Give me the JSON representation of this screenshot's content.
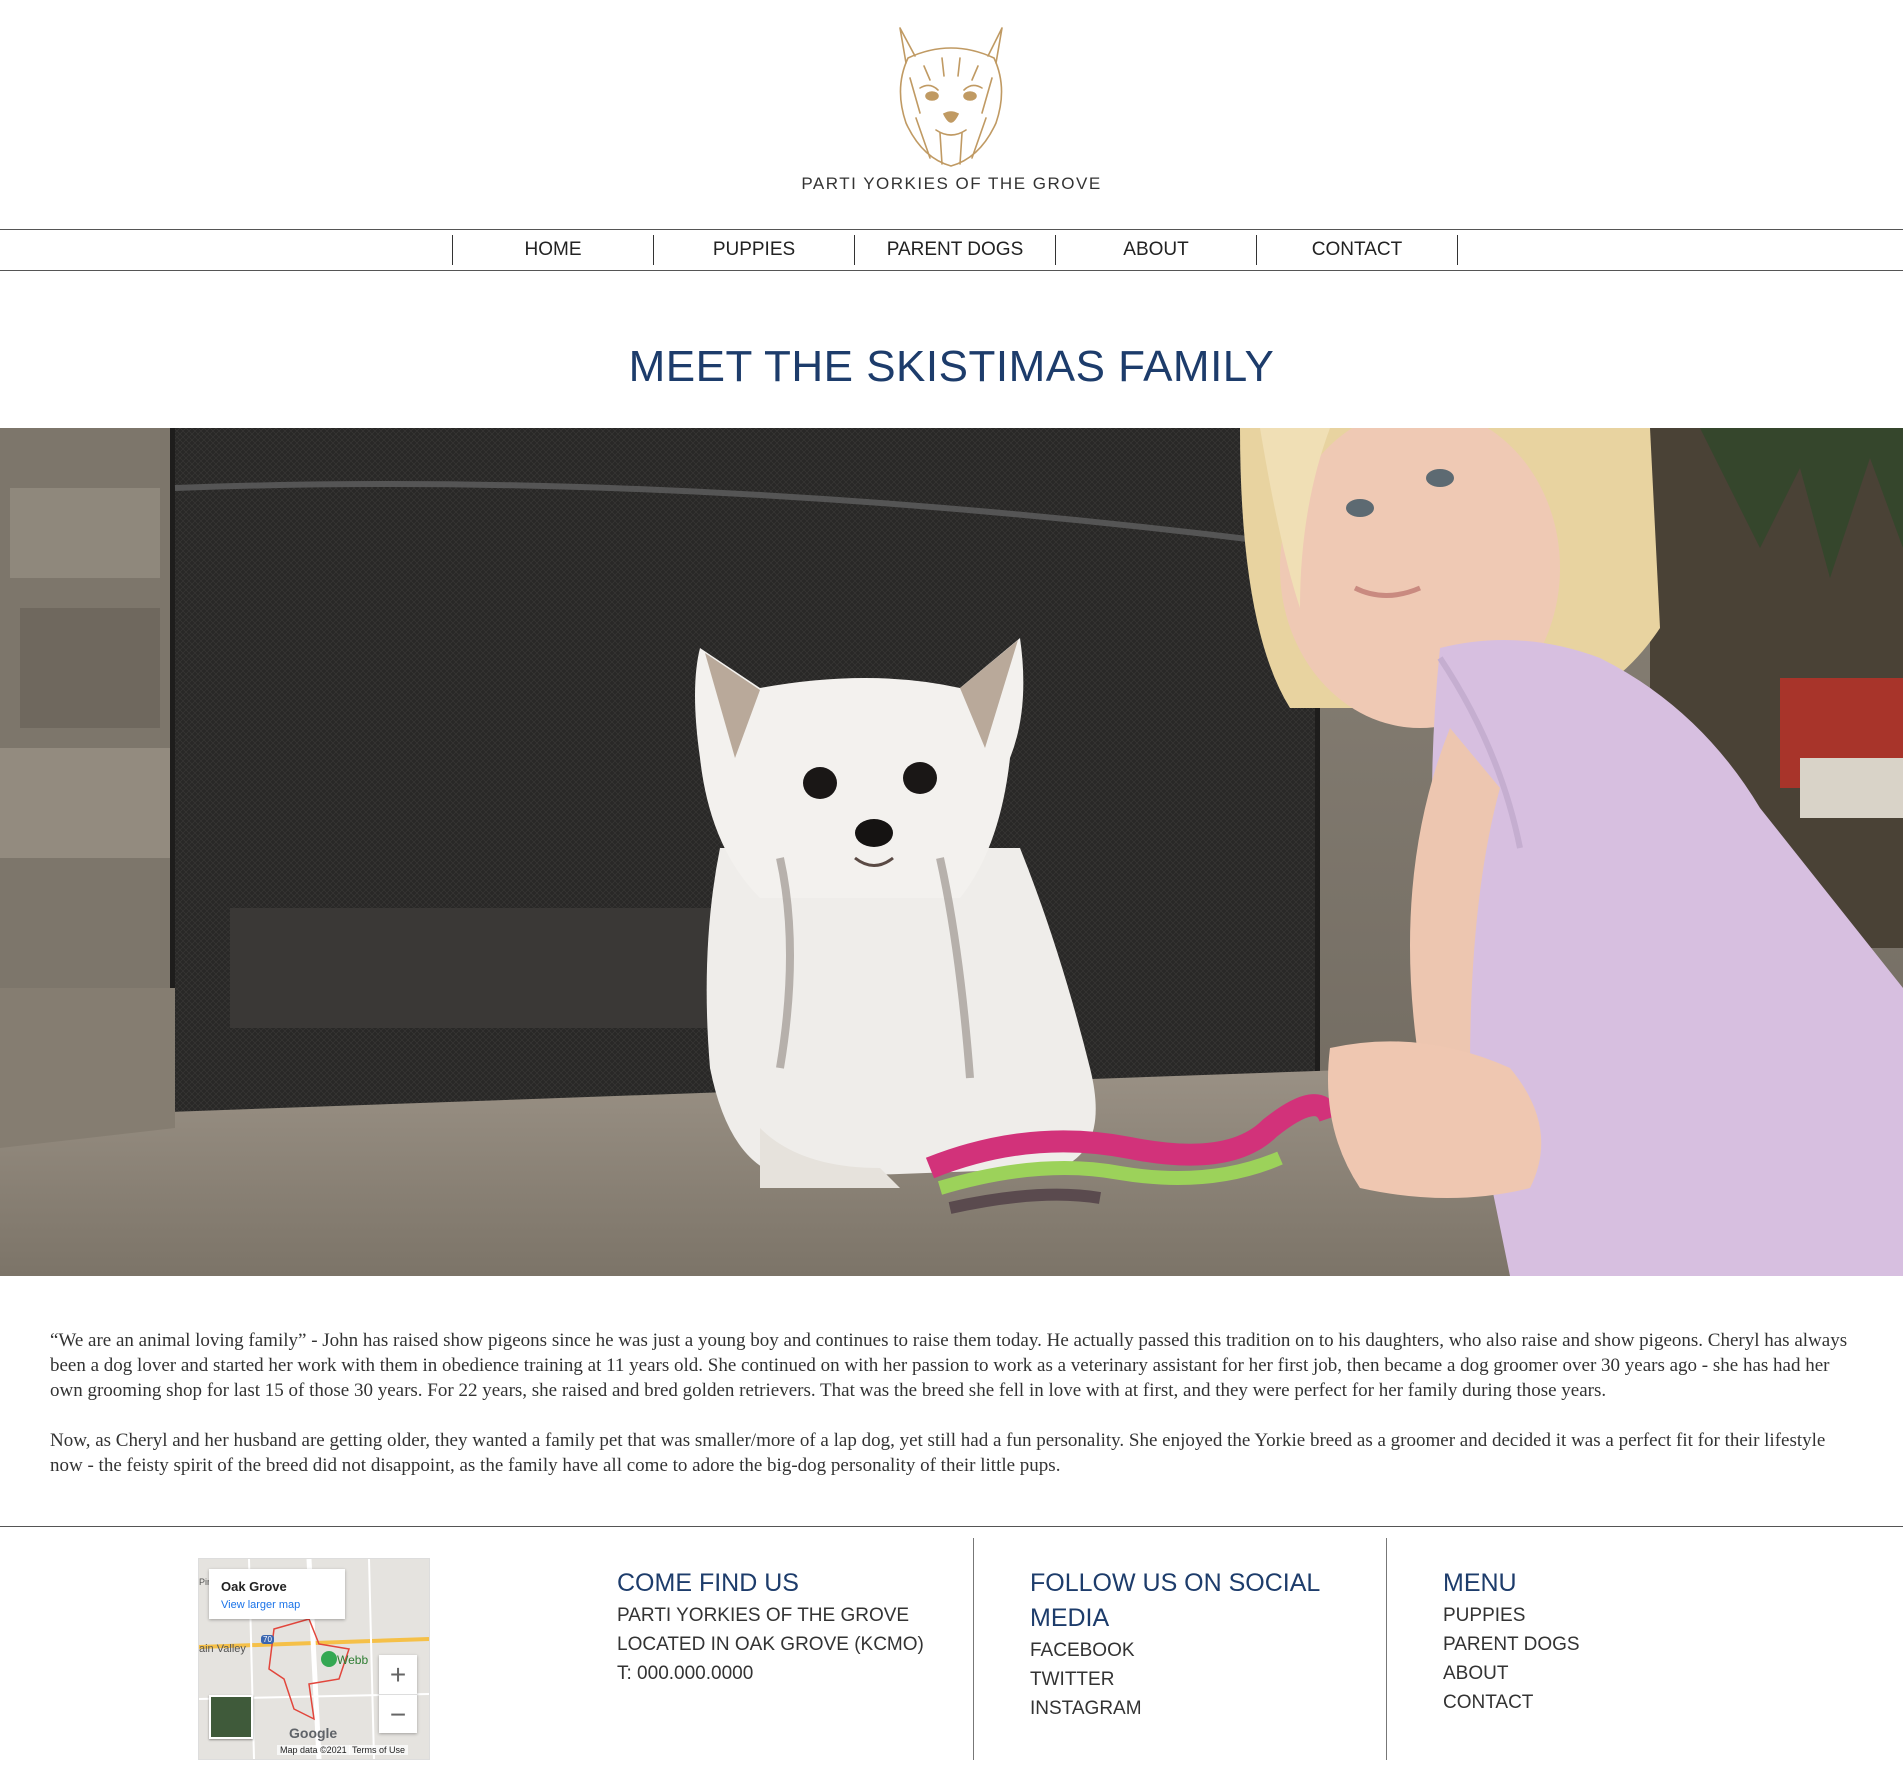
{
  "site": {
    "brand_name": "PARTI YORKIES OF THE GROVE"
  },
  "nav": {
    "items": [
      {
        "label": "HOME"
      },
      {
        "label": "PUPPIES"
      },
      {
        "label": "PARENT DOGS"
      },
      {
        "label": "ABOUT"
      },
      {
        "label": "CONTACT"
      }
    ]
  },
  "main": {
    "title": "MEET THE SKISTIMAS FAMILY",
    "paragraphs": [
      "“We are an animal loving family” - John has raised show pigeons since he was just a young boy and continues to raise them today. He actually passed this tradition on to his daughters, who also raise and show pigeons. Cheryl has always been a dog lover and started her work with them in obedience training at 11 years old. She continued on with her passion to work as a veterinary assistant for her first job, then became a dog groomer over 30 years ago - she has had her own grooming shop for last 15 of those 30 years. For 22 years, she raised and bred golden retrievers. That was the breed she fell in love with at first, and they were perfect for her family during those years.",
      "Now, as Cheryl and her husband are getting older, they wanted a family pet that was smaller/more of a lap dog, yet still had a fun personality. She enjoyed the Yorkie breed as a groomer and decided it was a perfect fit for their lifestyle now - the feisty spirit of the breed did not disappoint, as the family have all come to adore the big-dog personality of their little pups."
    ]
  },
  "footer": {
    "map": {
      "place": "Oak Grove",
      "link": "View larger map",
      "labels": [
        "Pin",
        "ain Valley",
        "Webb",
        "70"
      ],
      "logo": "Google",
      "attribution": "Map data ©2021",
      "terms": "Terms of Use"
    },
    "find": {
      "heading": "COME FIND US",
      "lines": [
        "PARTI YORKIES OF THE GROVE",
        "LOCATED IN OAK GROVE (KCMO)",
        "T: 000.000.0000"
      ]
    },
    "social": {
      "heading_line1": "FOLLOW US ON SOCIAL",
      "heading_line2": "MEDIA",
      "links": [
        "FACEBOOK",
        "TWITTER",
        "INSTAGRAM"
      ]
    },
    "menu": {
      "heading": "MENU",
      "links": [
        "PUPPIES",
        "PARENT DOGS",
        "ABOUT",
        "CONTACT"
      ]
    }
  },
  "colors": {
    "accent_navy": "#1d3c6b",
    "logo_gold": "#c09a63"
  }
}
